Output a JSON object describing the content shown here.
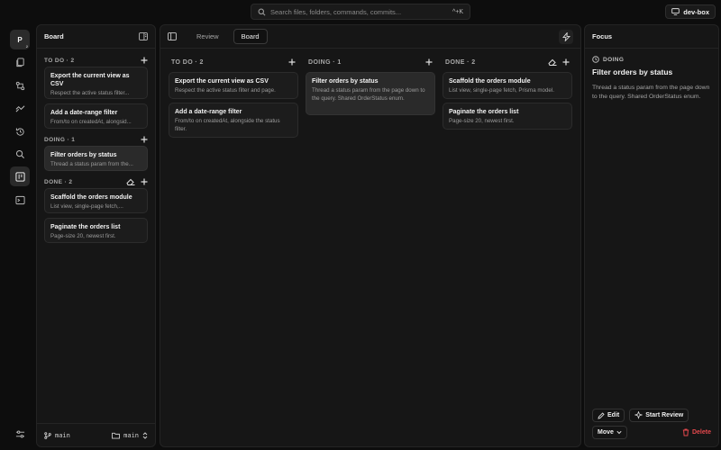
{
  "search": {
    "placeholder": "Search files, folders, commands, commits...",
    "shortcut": "^+K"
  },
  "devbox": {
    "label": "dev-box"
  },
  "rail": {
    "avatar": "P",
    "avatar_sub": "2",
    "items": [
      "files-icon",
      "git-icon",
      "flow-icon",
      "history-icon",
      "search-icon",
      "board-icon",
      "terminal-icon"
    ],
    "settings": "sliders-icon"
  },
  "sidebar": {
    "title": "Board",
    "sections": [
      {
        "label": "TO DO · 2",
        "cards": [
          {
            "title": "Export the current view as CSV",
            "desc": "Respect the active status filter..."
          },
          {
            "title": "Add a date-range filter",
            "desc": "From/to on createdAt, alongsid..."
          }
        ]
      },
      {
        "label": "DOING · 1",
        "cards": [
          {
            "title": "Filter orders by status",
            "desc": "Thread a status param from the..."
          }
        ]
      },
      {
        "label": "DONE · 2",
        "cards": [
          {
            "title": "Scaffold the orders module",
            "desc": "List view, single-page fetch,..."
          },
          {
            "title": "Paginate the orders list",
            "desc": "Page-size 20, newest first."
          }
        ]
      }
    ],
    "footer": {
      "branch": "main",
      "folder": "main"
    }
  },
  "main": {
    "tabs": [
      {
        "label": "Review"
      },
      {
        "label": "Board"
      }
    ],
    "columns": [
      {
        "label": "TO DO · 2",
        "cards": [
          {
            "title": "Export the current view as CSV",
            "desc": "Respect the active status filter and page."
          },
          {
            "title": "Add a date-range filter",
            "desc": "From/to on createdAt, alongside the status filter."
          }
        ]
      },
      {
        "label": "DOING · 1",
        "cards": [
          {
            "title": "Filter orders by status",
            "desc": "Thread a status param from the page down to the query. Shared OrderStatus enum."
          }
        ]
      },
      {
        "label": "DONE · 2",
        "cards": [
          {
            "title": "Scaffold the orders module",
            "desc": "List view, single-page fetch, Prisma model."
          },
          {
            "title": "Paginate the orders list",
            "desc": "Page-size 20, newest first."
          }
        ]
      }
    ]
  },
  "focus": {
    "title": "Focus",
    "status": "DOING",
    "task_title": "Filter orders by status",
    "task_desc": "Thread a status param from the page down to the query. Shared OrderStatus enum.",
    "edit_label": "Edit",
    "start_review_label": "Start Review",
    "move_label": "Move",
    "delete_label": "Delete"
  },
  "colors": {
    "background": "#0d0d0d",
    "panel": "#161616",
    "card": "#1c1c1c",
    "danger": "#e5484d"
  }
}
